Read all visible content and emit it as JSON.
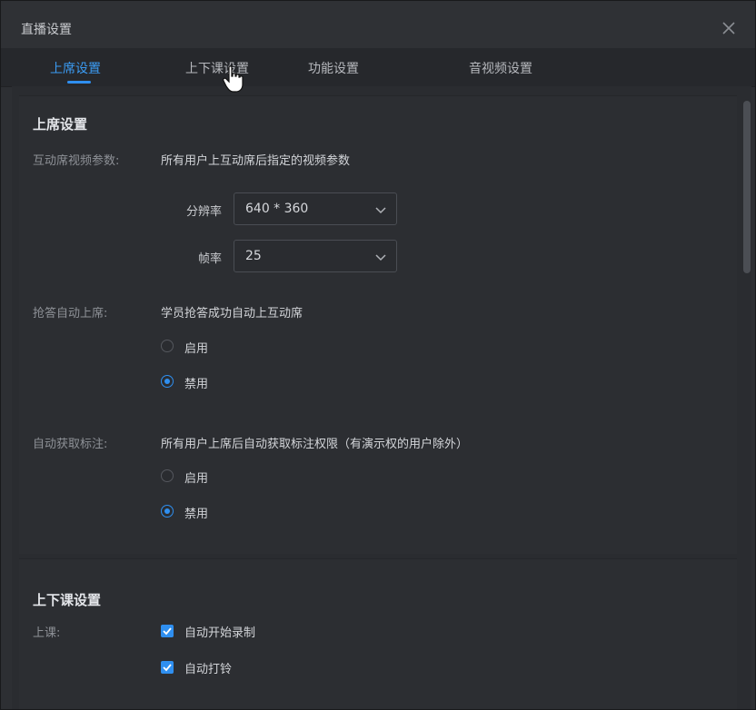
{
  "window": {
    "title": "直播设置"
  },
  "tabs": [
    {
      "label": "上席设置",
      "active": true
    },
    {
      "label": "上下课设置",
      "active": false
    },
    {
      "label": "功能设置",
      "active": false
    },
    {
      "label": "音视频设置",
      "active": false
    }
  ],
  "seat_section": {
    "title": "上席设置",
    "video_params": {
      "label": "互动席视频参数:",
      "description": "所有用户上互动席后指定的视频参数",
      "resolution_label": "分辨率",
      "resolution_value": "640 * 360",
      "framerate_label": "帧率",
      "framerate_value": "25"
    },
    "auto_seat": {
      "label": "抢答自动上席:",
      "description": "学员抢答成功自动上互动席",
      "options": [
        "启用",
        "禁用"
      ],
      "selected": "禁用"
    },
    "auto_annotate": {
      "label": "自动获取标注:",
      "description": "所有用户上席后自动获取标注权限（有演示权的用户除外）",
      "options": [
        "启用",
        "禁用"
      ],
      "selected": "禁用"
    }
  },
  "class_section": {
    "title": "上下课设置",
    "start_class": {
      "label": "上课:",
      "options": [
        {
          "label": "自动开始录制",
          "checked": true
        },
        {
          "label": "自动打铃",
          "checked": true
        }
      ]
    }
  },
  "colors": {
    "accent": "#2f8ff0",
    "background": "#2d2f33"
  }
}
